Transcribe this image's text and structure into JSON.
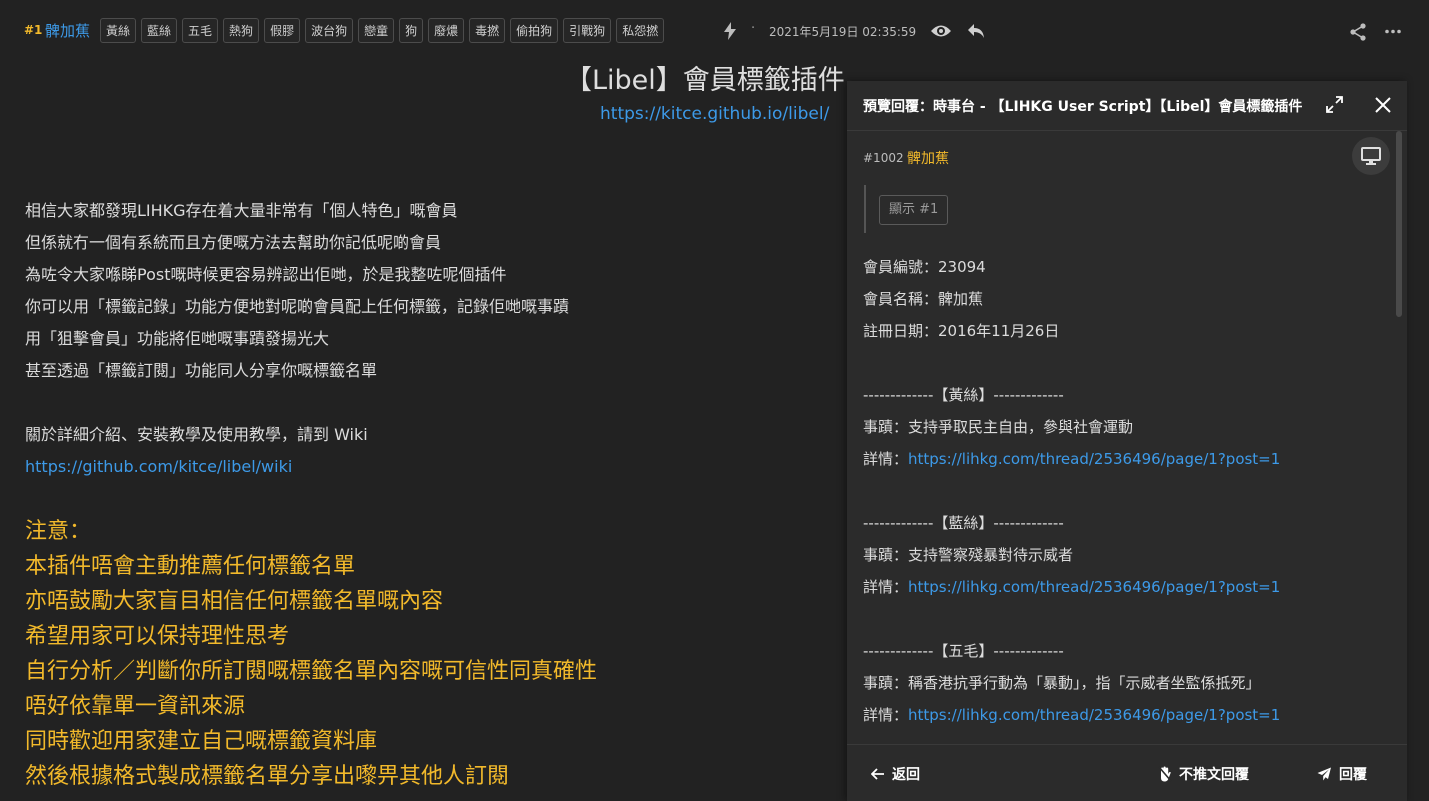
{
  "post": {
    "floor": "#1",
    "author": "髀加蕉",
    "tags": [
      "黃絲",
      "藍絲",
      "五毛",
      "熱狗",
      "假膠",
      "波台狗",
      "戀童",
      "狗",
      "廢燶",
      "毒撚",
      "偷拍狗",
      "引戰狗",
      "私怨撚"
    ],
    "separator": "·",
    "timestamp": "2021年5月19日 02:35:59",
    "title": "【Libel】會員標籤插件",
    "title_link": "https://kitce.github.io/libel/",
    "body_lines": [
      "相信大家都發現LIHKG存在着大量非常有「個人特色」嘅會員",
      "但係就冇一個有系統而且方便嘅方法去幫助你記低呢啲會員",
      "為咗令大家喺睇Post嘅時候更容易辨認出佢哋，於是我整咗呢個插件",
      "你可以用「標籤記錄」功能方便地對呢啲會員配上任何標籤，記錄佢哋嘅事蹟",
      "用「狙擊會員」功能將佢哋嘅事蹟發揚光大",
      "甚至透過「標籤訂閱」功能同人分享你嘅標籤名單"
    ],
    "wiki_intro": "關於詳細介紹、安裝教學及使用教學，請到 Wiki",
    "wiki_link": "https://github.com/kitce/libel/wiki",
    "warning_lines": [
      "注意：",
      "本插件唔會主動推薦任何標籤名單",
      "亦唔鼓勵大家盲目相信任何標籤名單嘅內容",
      "希望用家可以保持理性思考",
      "自行分析／判斷你所訂閱嘅標籤名單內容嘅可信性同真確性",
      "唔好依靠單一資訊來源",
      "同時歡迎用家建立自己嘅標籤資料庫",
      "然後根據格式製成標籤名單分享出嚟畀其他人訂閱"
    ]
  },
  "preview": {
    "title": "預覽回覆：時事台 - 【LIHKG User Script】【Libel】會員標籤插件",
    "reply_floor": "#1002",
    "reply_author": "髀加蕉",
    "show_quote": "顯示 #1",
    "member_lines": [
      "會員編號：23094",
      "會員名稱：髀加蕉",
      "註冊日期：2016年11月26日"
    ],
    "entries": [
      {
        "header": "-------------【黃絲】-------------",
        "event": "事蹟：支持爭取民主自由，參與社會運動",
        "detail_label": "詳情：",
        "detail_link": "https://lihkg.com/thread/2536496/page/1?post=1"
      },
      {
        "header": "-------------【藍絲】-------------",
        "event": "事蹟：支持警察殘暴對待示威者",
        "detail_label": "詳情：",
        "detail_link": "https://lihkg.com/thread/2536496/page/1?post=1"
      },
      {
        "header": "-------------【五毛】-------------",
        "event": "事蹟：稱香港抗爭行動為「暴動」，指「示威者坐監係抵死」",
        "detail_label": "詳情：",
        "detail_link": "https://lihkg.com/thread/2536496/page/1?post=1"
      }
    ],
    "footer": {
      "back": "返回",
      "hide_reply": "不推文回覆",
      "reply": "回覆"
    }
  },
  "colors": {
    "accent_gold": "#f2b92b",
    "link_blue": "#3d9ae8",
    "background": "#222222",
    "panel": "#2b2b2b"
  }
}
